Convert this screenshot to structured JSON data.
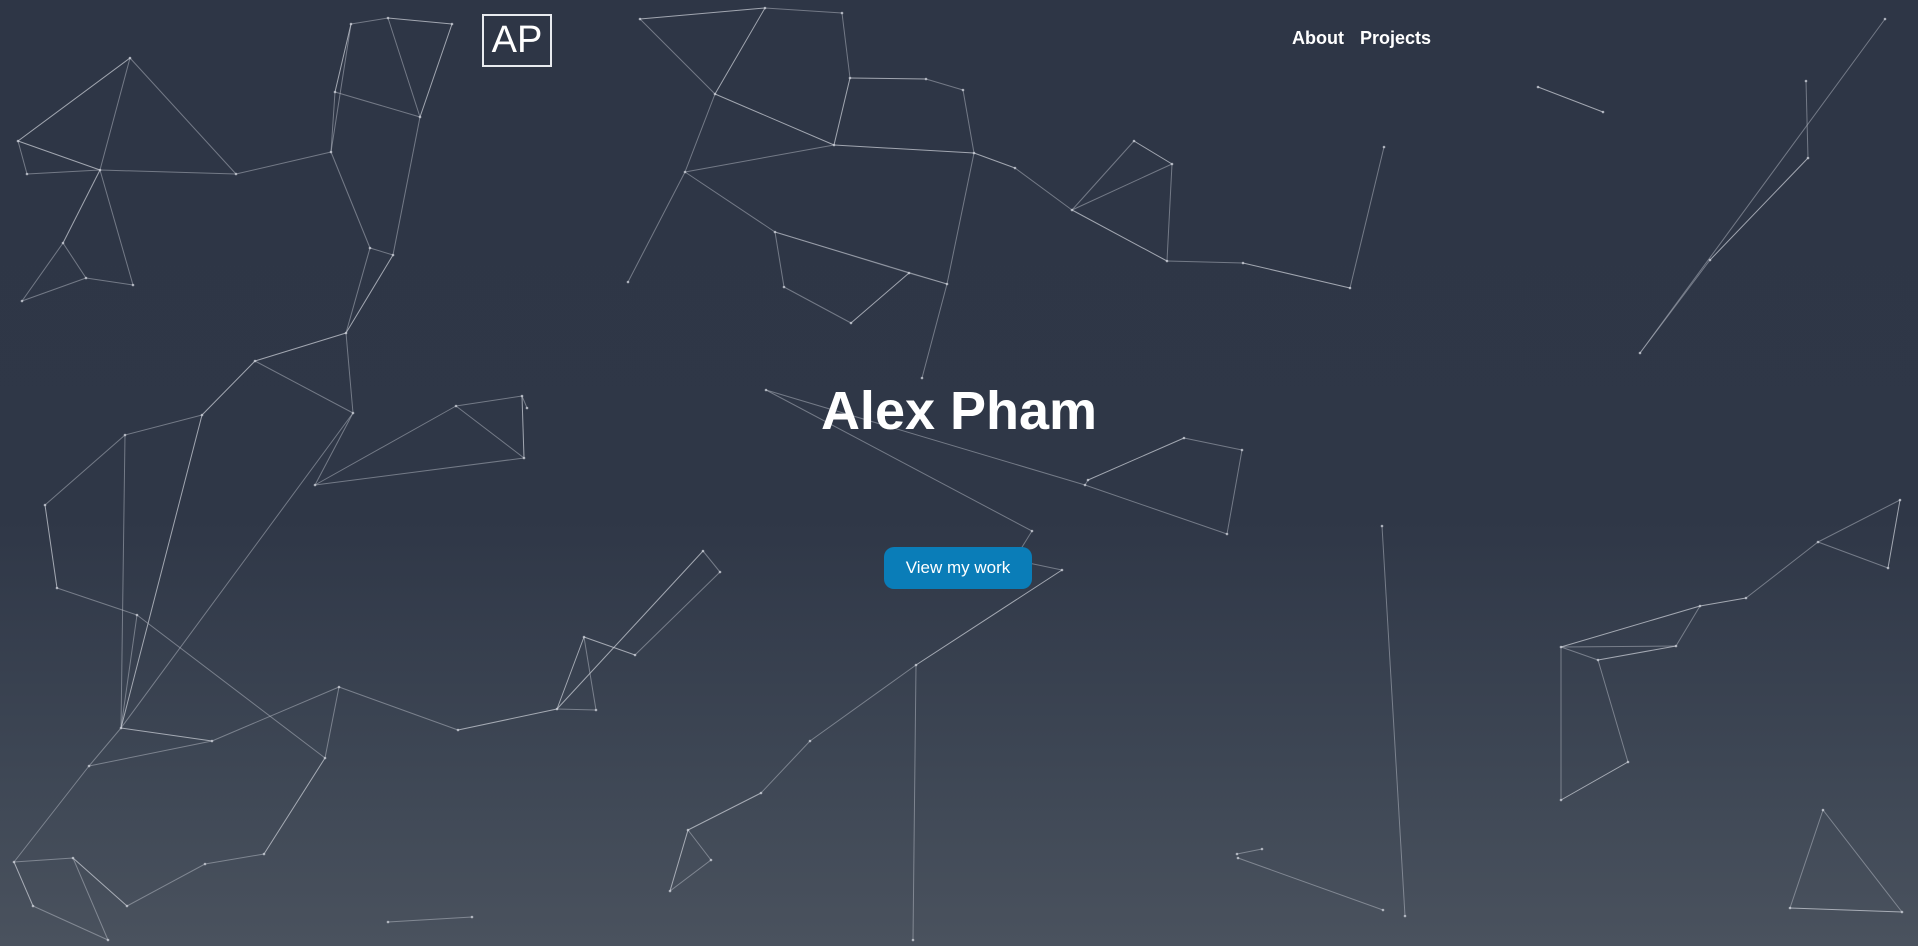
{
  "logo": {
    "text": "AP"
  },
  "nav": {
    "items": [
      "About",
      "Projects"
    ]
  },
  "hero": {
    "name": "Alex Pham",
    "cta_label": "View my work"
  },
  "colors": {
    "background_top": "#2e3646",
    "background_bottom": "#4a525e",
    "accent": "#0a7db8",
    "line": "#c8ccd4"
  }
}
